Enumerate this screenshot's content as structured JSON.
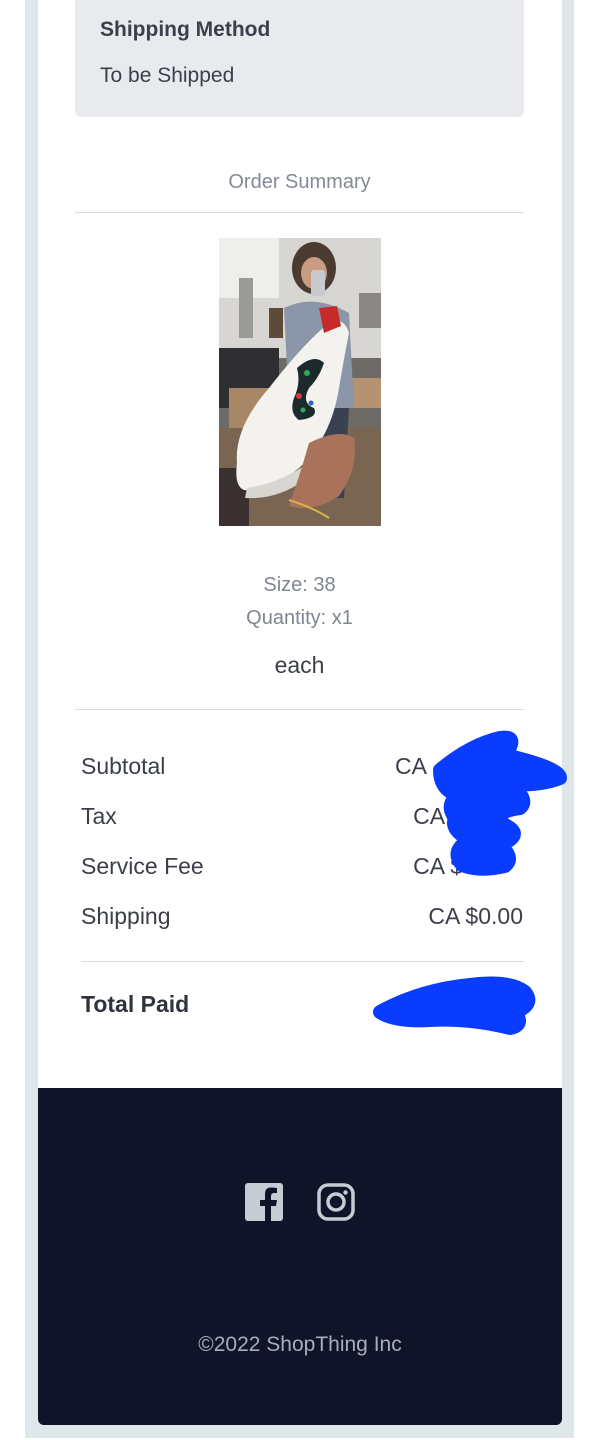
{
  "shipping": {
    "title": "Shipping Method",
    "value": "To be Shipped"
  },
  "order_summary": {
    "heading": "Order Summary",
    "item": {
      "image_alt": "white sneaker with embroidered snake",
      "size": "Size: 38",
      "quantity": "Quantity: x1",
      "price_unit": "each"
    }
  },
  "totals": {
    "rows": [
      {
        "label": "Subtotal",
        "value": "CA"
      },
      {
        "label": "Tax",
        "value": "CA $"
      },
      {
        "label": "Service Fee",
        "value": "CA $"
      },
      {
        "label": "Shipping",
        "value": "CA $0.00"
      }
    ],
    "total_label": "Total Paid",
    "redaction_color": "#0a3cff"
  },
  "footer": {
    "icons": [
      "facebook-icon",
      "instagram-icon"
    ],
    "copyright": "©2022 ShopThing Inc"
  }
}
